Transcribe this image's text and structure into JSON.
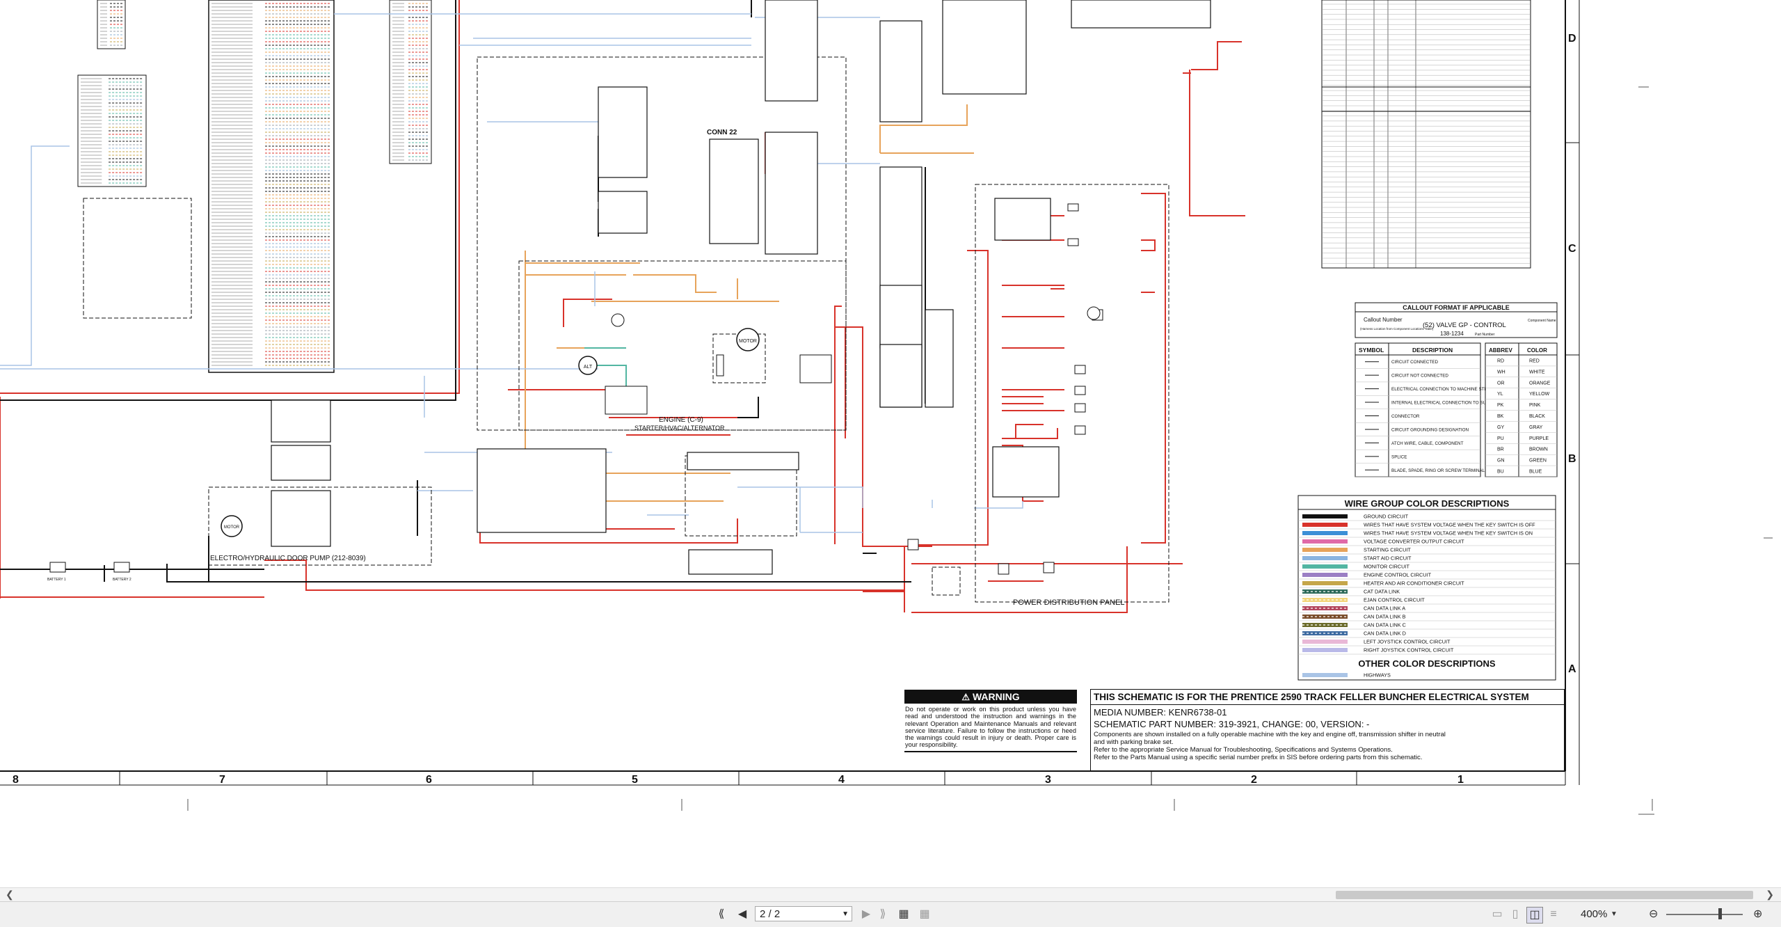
{
  "colors": {
    "red": "#d8322a",
    "orange": "#e7a35a",
    "blue": "#8fb3d6",
    "teal": "#52b6a2",
    "green": "#4aa54a",
    "black": "#111111",
    "grey": "#9aa0a8"
  },
  "labels": {
    "conn22": "CONN 22",
    "engine_block": "ENGINE (C-9)",
    "engine_block2": "STARTER/HVAC/ALTERNATOR",
    "door_pump": "ELECTRO/HYDRAULIC DOOR PUMP (212-8039)",
    "power_dist": "POWER DISTRIBUTION PANEL",
    "starter_motor": "MOTOR",
    "alternator": "ALT",
    "door_motor": "MOTOR",
    "battery1": "BATTERY 1",
    "battery2": "BATTERY 2"
  },
  "border": {
    "columns": [
      "8",
      "7",
      "6",
      "5",
      "4",
      "3",
      "2",
      "1"
    ],
    "rows": [
      "D",
      "C",
      "B",
      "A"
    ]
  },
  "callout": {
    "title": "CALLOUT FORMAT IF APPLICABLE",
    "callout_number_label": "Callout Number",
    "location_note": "(Harness Location from Component Locations Table)",
    "example": "(52) VALVE GP - CONTROL",
    "example_part": "138-1234",
    "component_name_label": "Component Name",
    "part_number_label": "Part Number"
  },
  "symbol_table": {
    "headers": [
      "SYMBOL",
      "DESCRIPTION"
    ],
    "rows": [
      "CIRCUIT CONNECTED",
      "CIRCUIT NOT CONNECTED",
      "ELECTRICAL CONNECTION TO MACHINE STRUCTURE",
      "INTERNAL ELECTRICAL CONNECTION TO SURFACE OF COMPONENT",
      "CONNECTOR",
      "CIRCUIT GROUNDING DESIGNATION",
      "ATCH WIRE, CABLE, COMPONENT",
      "SPLICE",
      "BLADE, SPADE, RING OR SCREW TERMINAL"
    ]
  },
  "abbrev_table": {
    "headers": [
      "ABBREV",
      "COLOR"
    ],
    "rows": [
      [
        "RD",
        "RED"
      ],
      [
        "WH",
        "WHITE"
      ],
      [
        "OR",
        "ORANGE"
      ],
      [
        "YL",
        "YELLOW"
      ],
      [
        "PK",
        "PINK"
      ],
      [
        "BK",
        "BLACK"
      ],
      [
        "GY",
        "GRAY"
      ],
      [
        "PU",
        "PURPLE"
      ],
      [
        "BR",
        "BROWN"
      ],
      [
        "GN",
        "GREEN"
      ],
      [
        "BU",
        "BLUE"
      ]
    ]
  },
  "wire_groups": {
    "title": "WIRE GROUP COLOR DESCRIPTIONS",
    "items": [
      {
        "label": "GROUND CIRCUIT",
        "color": "#111111"
      },
      {
        "label": "WIRES THAT HAVE SYSTEM VOLTAGE WHEN THE KEY SWITCH IS OFF",
        "color": "#d8322a"
      },
      {
        "label": "WIRES THAT HAVE SYSTEM VOLTAGE WHEN THE KEY SWITCH IS ON",
        "color": "#3b8fd6"
      },
      {
        "label": "VOLTAGE CONVERTER OUTPUT CIRCUIT",
        "color": "#e06aa8"
      },
      {
        "label": "STARTING CIRCUIT",
        "color": "#e7a35a"
      },
      {
        "label": "START AID CIRCUIT",
        "color": "#8ab4e0"
      },
      {
        "label": "MONITOR CIRCUIT",
        "color": "#52b6a2"
      },
      {
        "label": "ENGINE CONTROL CIRCUIT",
        "color": "#9b7fc4"
      },
      {
        "label": "HEATER AND AIR CONDITIONER CIRCUIT",
        "color": "#c5a64a"
      },
      {
        "label": "CAT DATA LINK",
        "color": "#2d6a5a"
      },
      {
        "label": "EJAN CONTROL CIRCUIT",
        "color": "#f2d47a"
      },
      {
        "label": "CAN DATA LINK A",
        "color": "#b3465d"
      },
      {
        "label": "CAN DATA LINK B",
        "color": "#7a4d2a"
      },
      {
        "label": "CAN DATA LINK C",
        "color": "#6b6b2a"
      },
      {
        "label": "CAN DATA LINK D",
        "color": "#3d6aa0"
      },
      {
        "label": "LEFT JOYSTICK CONTROL CIRCUIT",
        "color": "#e9b8d6"
      },
      {
        "label": "RIGHT JOYSTICK CONTROL CIRCUIT",
        "color": "#b9b9e8"
      }
    ],
    "other_title": "OTHER COLOR DESCRIPTIONS",
    "other_items": [
      {
        "label": "HIGHWAYS",
        "color": "#a9c4e6"
      }
    ]
  },
  "warning": {
    "title": "WARNING",
    "body": "Do not operate or work on this product unless you have read and understood the instruction and warnings in the relevant Operation and Maintenance Manuals and relevant service literature. Failure to follow the instructions or heed the warnings could result in injury or death. Proper care is your responsibility."
  },
  "title_block": {
    "title": "THIS SCHEMATIC IS FOR THE PRENTICE 2590 TRACK FELLER BUNCHER ELECTRICAL SYSTEM",
    "media": "MEDIA NUMBER: KENR6738-01",
    "part": "SCHEMATIC PART NUMBER: 319-3921, CHANGE: 00, VERSION: -",
    "notes": [
      "Components are shown installed on a fully operable machine with the key and engine off, transmission shifter in neutral and with parking brake set.",
      "Refer to the appropriate Service Manual for Troubleshooting, Specifications and Systems Operations.",
      "Refer to the Parts Manual using a specific serial number prefix in SIS before ordering parts from this schematic."
    ]
  },
  "viewer": {
    "page_value": "2 / 2",
    "zoom": "400%"
  }
}
